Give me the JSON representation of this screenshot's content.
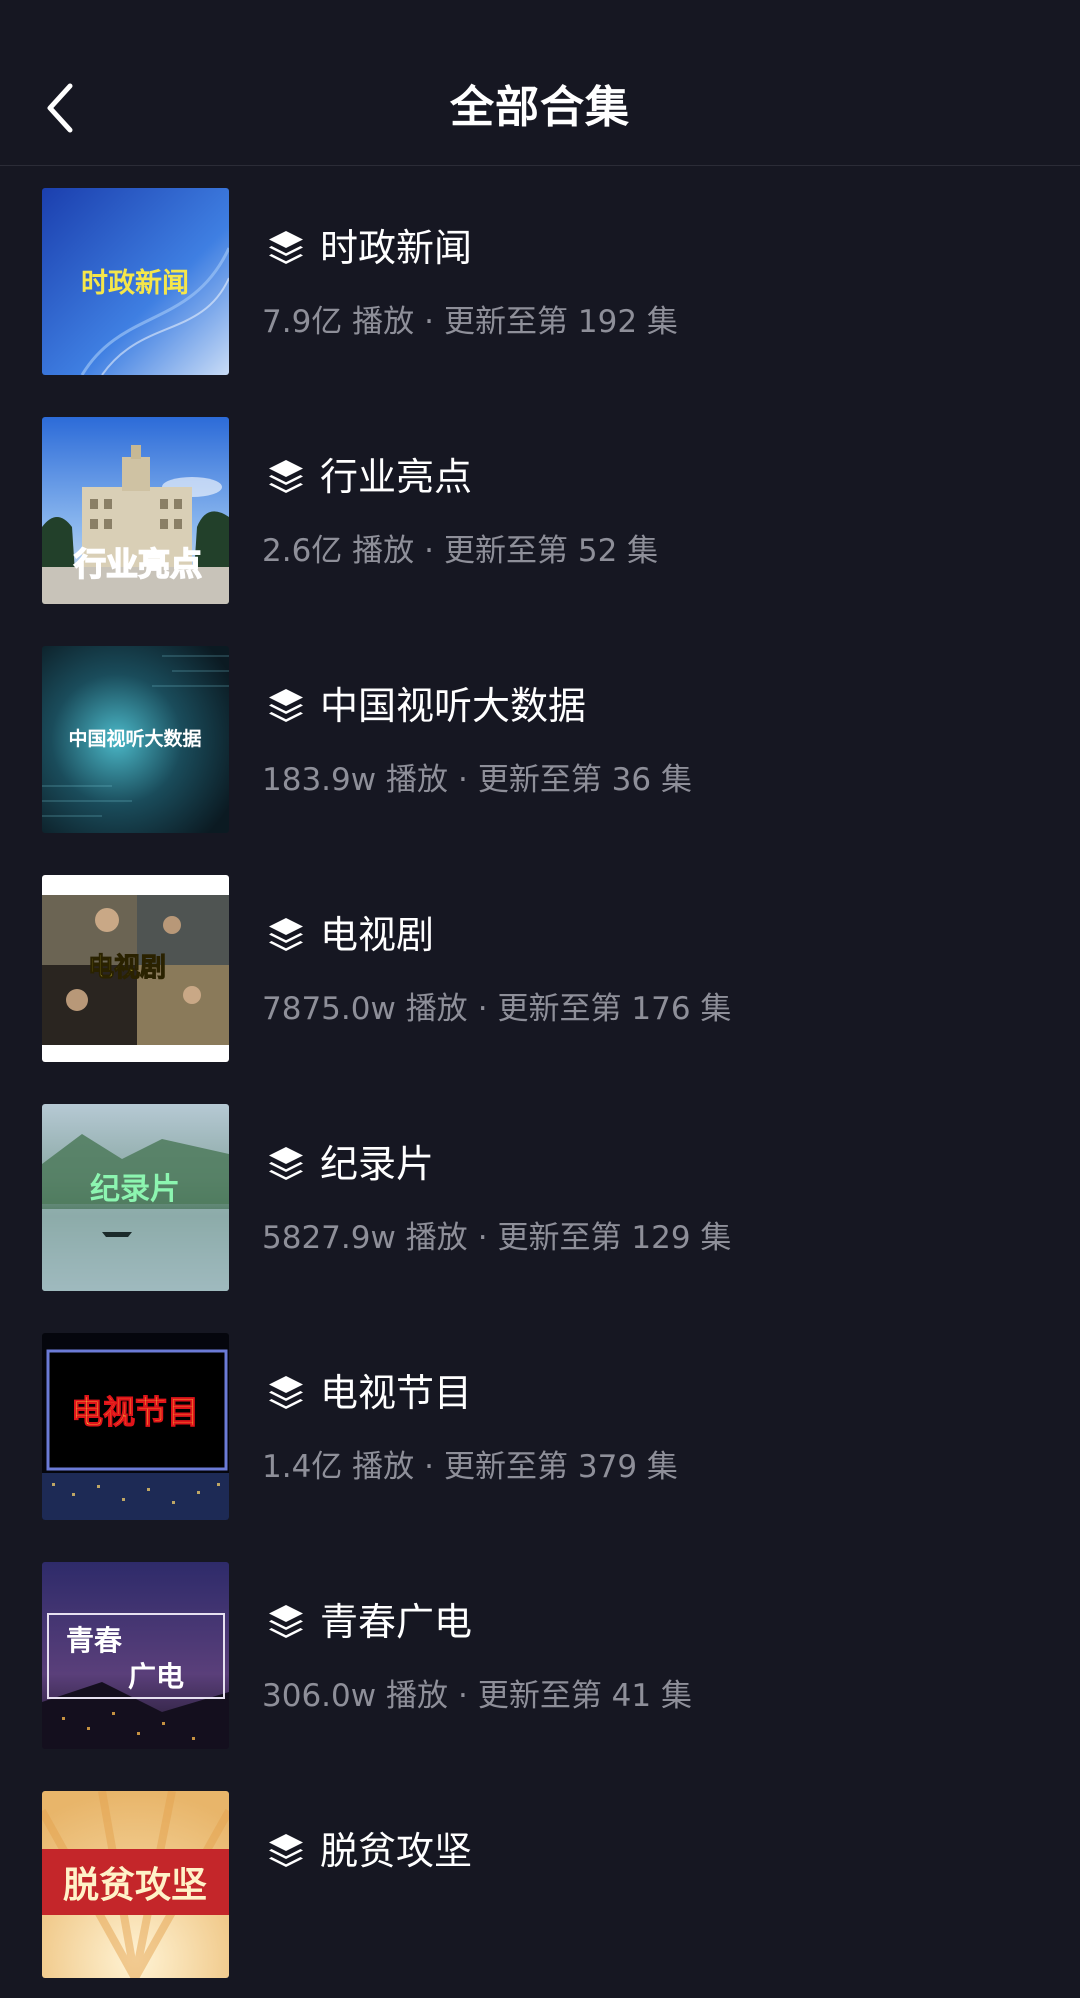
{
  "header": {
    "title": "全部合集",
    "back_icon": "chevron-left-icon"
  },
  "colors": {
    "background": "#161722",
    "title": "#ffffff",
    "meta": "#8e8f99"
  },
  "collections": [
    {
      "title": "时政新闻",
      "plays": "7.9亿",
      "play_label": "播放",
      "update": "更新至第 192 集",
      "thumb_text": "时政新闻"
    },
    {
      "title": "行业亮点",
      "plays": "2.6亿",
      "play_label": "播放",
      "update": "更新至第 52 集",
      "thumb_text": "行业亮点"
    },
    {
      "title": "中国视听大数据",
      "plays": "183.9w",
      "play_label": "播放",
      "update": "更新至第 36 集",
      "thumb_text": "中国视听大数据"
    },
    {
      "title": "电视剧",
      "plays": "7875.0w",
      "play_label": "播放",
      "update": "更新至第 176 集",
      "thumb_text": "电视剧"
    },
    {
      "title": "纪录片",
      "plays": "5827.9w",
      "play_label": "播放",
      "update": "更新至第 129 集",
      "thumb_text": "纪录片"
    },
    {
      "title": "电视节目",
      "plays": "1.4亿",
      "play_label": "播放",
      "update": "更新至第 379 集",
      "thumb_text": "电视节目"
    },
    {
      "title": "青春广电",
      "plays": "306.0w",
      "play_label": "播放",
      "update": "更新至第 41 集",
      "thumb_text_1": "青春",
      "thumb_text_2": "广电"
    },
    {
      "title": "脱贫攻坚",
      "plays": "",
      "play_label": "",
      "update": "",
      "thumb_text": "脱贫攻坚"
    }
  ]
}
